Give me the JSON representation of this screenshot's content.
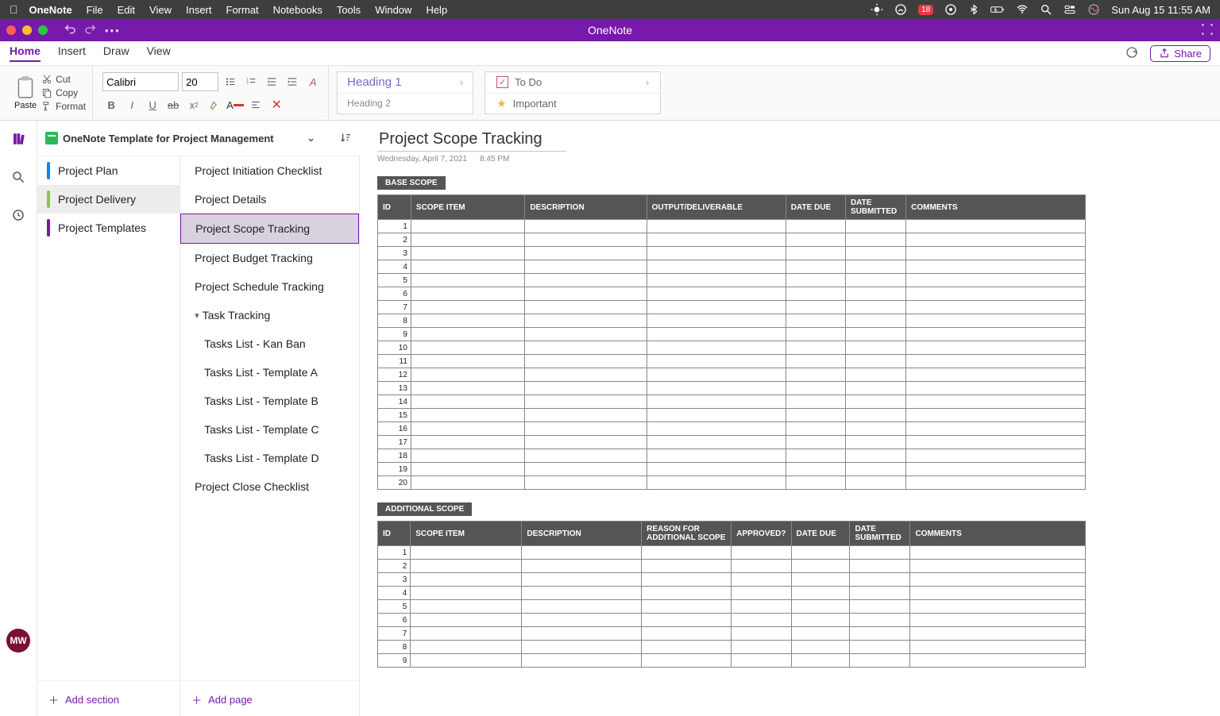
{
  "mac_menu": {
    "app": "OneNote",
    "items": [
      "File",
      "Edit",
      "View",
      "Insert",
      "Format",
      "Notebooks",
      "Tools",
      "Window",
      "Help"
    ],
    "badge": "18",
    "clock": "Sun Aug 15  11:55 AM"
  },
  "titlebar": {
    "app_title": "OneNote"
  },
  "ribbon_tabs": [
    "Home",
    "Insert",
    "Draw",
    "View"
  ],
  "ribbon_active": 0,
  "share_label": "Share",
  "clipboard": {
    "paste": "Paste",
    "cut": "Cut",
    "copy": "Copy",
    "format": "Format"
  },
  "font": {
    "name": "Calibri",
    "size": "20"
  },
  "styles": {
    "h1": "Heading 1",
    "h2": "Heading 2"
  },
  "tags": {
    "todo": "To Do",
    "important": "Important"
  },
  "notebook_name": "OneNote Template for Project Management",
  "sections": [
    {
      "name": "Project Plan",
      "color": "#0a84ff"
    },
    {
      "name": "Project Delivery",
      "color": "#8bc34a",
      "active": true
    },
    {
      "name": "Project Templates",
      "color": "#7719AA"
    }
  ],
  "add_section": "Add section",
  "pages": [
    {
      "name": "Project Initiation Checklist"
    },
    {
      "name": "Project Details"
    },
    {
      "name": "Project Scope Tracking",
      "active": true
    },
    {
      "name": "Project Budget Tracking"
    },
    {
      "name": "Project Schedule Tracking"
    },
    {
      "name": "Task Tracking",
      "hasCaret": true
    },
    {
      "name": "Tasks List - Kan Ban",
      "sub": true
    },
    {
      "name": "Tasks List - Template A",
      "sub": true
    },
    {
      "name": "Tasks List - Template B",
      "sub": true
    },
    {
      "name": "Tasks List - Template C",
      "sub": true
    },
    {
      "name": "Tasks List - Template D",
      "sub": true
    },
    {
      "name": "Project Close Checklist"
    }
  ],
  "add_page": "Add page",
  "page": {
    "title": "Project Scope Tracking",
    "date": "Wednesday, April 7, 2021",
    "time": "8:45 PM",
    "base_label": "BASE SCOPE",
    "additional_label": "ADDITIONAL SCOPE",
    "base_headers": [
      "ID",
      "SCOPE ITEM",
      "DESCRIPTION",
      "OUTPUT/DELIVERABLE",
      "DATE DUE",
      "DATE SUBMITTED",
      "COMMENTS"
    ],
    "additional_headers": [
      "ID",
      "SCOPE ITEM",
      "DESCRIPTION",
      "REASON FOR ADDITIONAL SCOPE",
      "APPROVED?",
      "DATE DUE",
      "DATE SUBMITTED",
      "COMMENTS"
    ],
    "base_rows": 20,
    "additional_rows_visible": 9
  },
  "avatar": "MW"
}
